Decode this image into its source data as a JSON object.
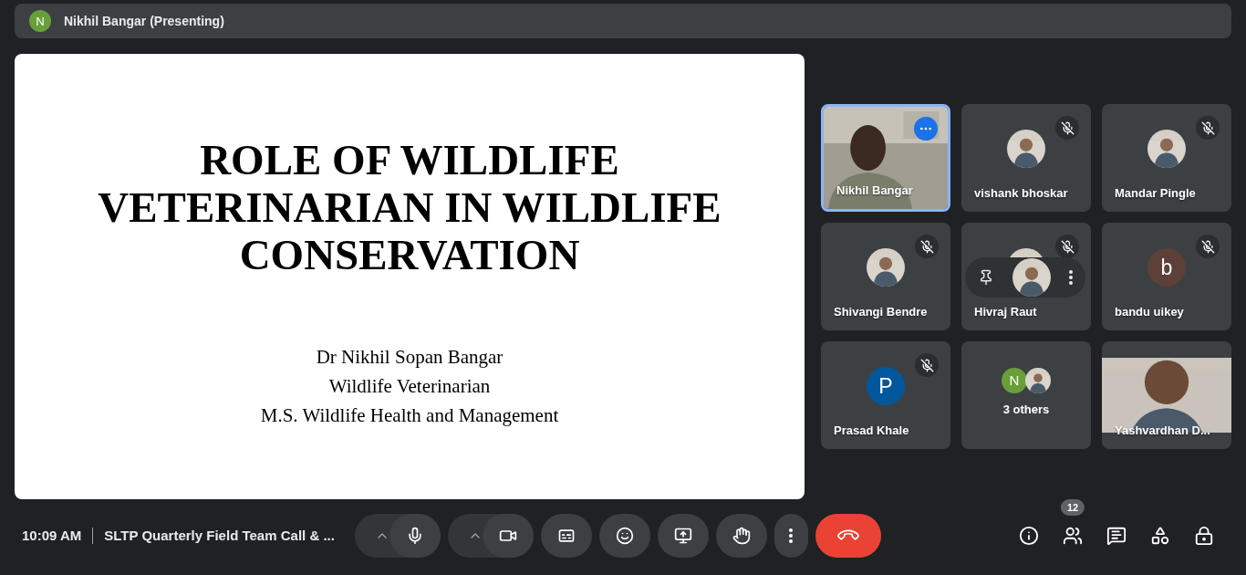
{
  "header": {
    "initial": "N",
    "title": "Nikhil Bangar (Presenting)"
  },
  "slide": {
    "title_lines": [
      "ROLE OF WILDLIFE",
      "VETERINARIAN IN WILDLIFE",
      "CONSERVATION"
    ],
    "subtitle_lines": [
      "Dr Nikhil Sopan Bangar",
      "Wildlife Veterinarian",
      "M.S. Wildlife Health and Management"
    ]
  },
  "tiles": [
    {
      "name": "Nikhil Bangar",
      "kind": "video",
      "muted": false,
      "speaking": true,
      "options_shown": true,
      "hovered": false
    },
    {
      "name": "vishank bhoskar",
      "muted": true,
      "speaking": false,
      "options_shown": false,
      "hovered": false
    },
    {
      "name": "Mandar Pingle",
      "muted": true,
      "speaking": false,
      "options_shown": false,
      "hovered": false
    },
    {
      "name": "Shivangi Bendre",
      "muted": true,
      "speaking": false,
      "options_shown": false,
      "hovered": false
    },
    {
      "name": "Hivraj Raut",
      "muted": true,
      "speaking": false,
      "options_shown": false,
      "hovered": true
    },
    {
      "name": "bandu uikey",
      "kind": "initial",
      "initial": "b",
      "color": "#5d4037",
      "muted": true,
      "speaking": false,
      "options_shown": false,
      "hovered": false
    },
    {
      "name": "Prasad Khale",
      "kind": "initial",
      "initial": "P",
      "color": "#01579b",
      "muted": true,
      "speaking": false,
      "options_shown": false,
      "hovered": false
    },
    {
      "name": "3 others",
      "kind": "others",
      "initial": "N",
      "color": "#689f38",
      "muted": false,
      "speaking": false,
      "options_shown": false,
      "hovered": false
    },
    {
      "name": "Yashvardhan D...",
      "kind": "letterbox",
      "muted": false,
      "speaking": false,
      "options_shown": false,
      "hovered": false
    }
  ],
  "footer": {
    "time": "10:09 AM",
    "meeting_title": "SLTP Quarterly Field Team Call & ...",
    "controls": [
      {
        "kind": "mic",
        "on": true,
        "has_menu": true
      },
      {
        "kind": "camera",
        "on": true,
        "has_menu": true
      },
      {
        "kind": "captions"
      },
      {
        "kind": "emoji"
      },
      {
        "kind": "present"
      },
      {
        "kind": "hand"
      },
      {
        "kind": "more"
      },
      {
        "kind": "end"
      }
    ],
    "side_buttons": [
      {
        "kind": "info"
      },
      {
        "kind": "people",
        "badge": "12"
      },
      {
        "kind": "chat"
      },
      {
        "kind": "activities"
      },
      {
        "kind": "host"
      }
    ]
  }
}
